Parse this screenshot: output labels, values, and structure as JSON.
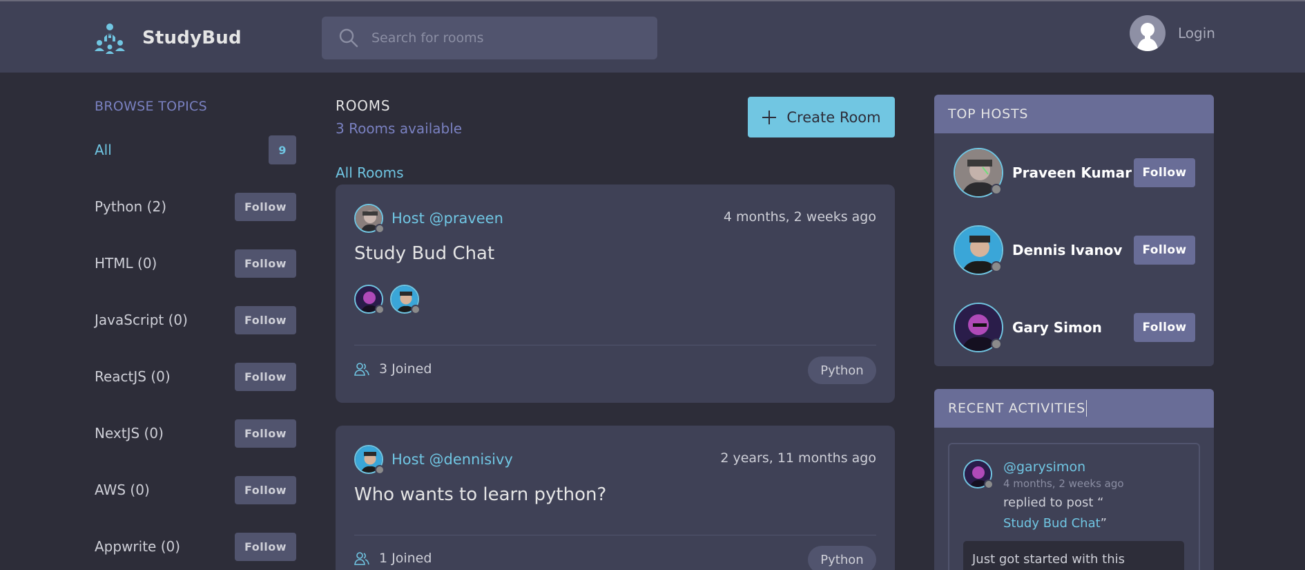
{
  "header": {
    "logo_text": "StudyBud",
    "search_placeholder": "Search for rooms",
    "login_label": "Login"
  },
  "sidebar": {
    "title": "BROWSE TOPICS",
    "all_label": "All",
    "all_count": "9",
    "follow_label": "Follow",
    "topics": [
      {
        "label": "Python (2)"
      },
      {
        "label": "HTML (0)"
      },
      {
        "label": "JavaScript (0)"
      },
      {
        "label": "ReactJS (0)"
      },
      {
        "label": "NextJS (0)"
      },
      {
        "label": "AWS (0)"
      },
      {
        "label": "Appwrite (0)"
      }
    ]
  },
  "main": {
    "heading": "ROOMS",
    "subheading": "3 Rooms available",
    "create_label": "Create Room",
    "all_rooms_label": "All Rooms",
    "rooms": [
      {
        "host": "Host @praveen",
        "time": "4 months, 2 weeks ago",
        "title": "Study Bud Chat",
        "joined": "3 Joined",
        "tag": "Python"
      },
      {
        "host": "Host @dennisivy",
        "time": "2 years, 11 months ago",
        "title": "Who wants to learn python?",
        "joined": "1 Joined",
        "tag": "Python"
      }
    ]
  },
  "top_hosts": {
    "title": "TOP HOSTS",
    "follow_label": "Follow",
    "hosts": [
      {
        "name": "Praveen Kumar"
      },
      {
        "name": "Dennis Ivanov"
      },
      {
        "name": "Gary Simon"
      }
    ]
  },
  "recent_activities": {
    "title": "RECENT ACTIVITIES",
    "items": [
      {
        "user": "@garysimon",
        "time": "4 months, 2 weeks ago",
        "action": "replied to post “",
        "post": "Study Bud Chat",
        "close": "”",
        "quote": "Just got started with this"
      }
    ]
  },
  "colors": {
    "background": "#2d2d39",
    "surface": "#3f4156",
    "accent": "#71c6e2",
    "panel_header": "#696d97",
    "muted_blue": "#7a81c1"
  }
}
